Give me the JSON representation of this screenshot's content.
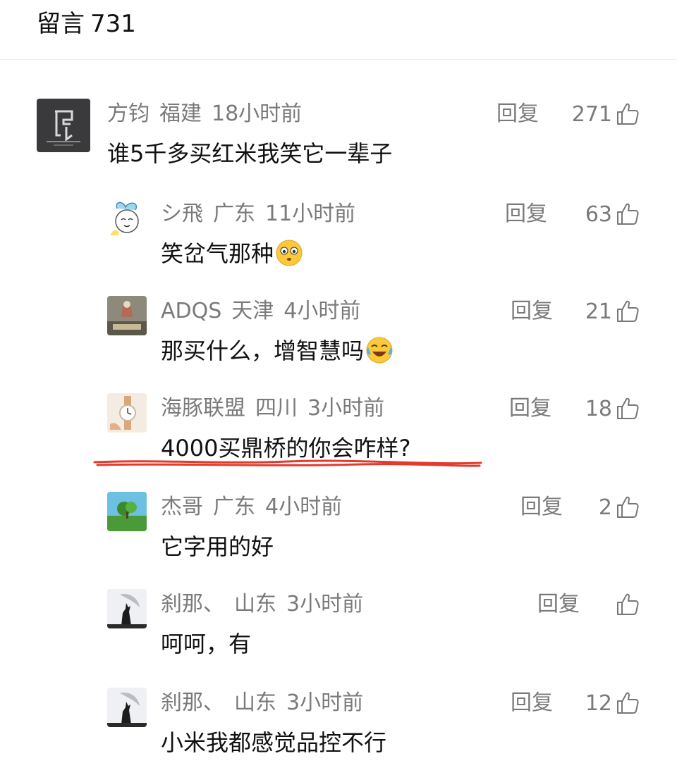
{
  "header": {
    "title": "留言",
    "count": "731"
  },
  "comments": [
    {
      "user": "方钧",
      "region": "福建",
      "time": "18小时前",
      "text": "谁5千多买红米我笑它一辈子",
      "reply_label": "回复",
      "likes": "271",
      "avatar_icon": "brand-logo-avatar"
    },
    {
      "user": "シ飛",
      "region": "广东",
      "time": "11小时前",
      "text": "笑岔气那种",
      "emoji": "flushed-face-emoji",
      "reply_label": "回复",
      "likes": "63",
      "avatar_icon": "cartoon-avatar"
    },
    {
      "user": "ADQS",
      "region": "天津",
      "time": "4小时前",
      "text": "那买什么，增智慧吗",
      "emoji": "crying-laughing-emoji",
      "reply_label": "回复",
      "likes": "21",
      "avatar_icon": "photo-avatar"
    },
    {
      "user": "海豚联盟",
      "region": "四川",
      "time": "3小时前",
      "text": "4000买鼎桥的你会咋样?",
      "reply_label": "回复",
      "likes": "18",
      "avatar_icon": "watch-avatar"
    },
    {
      "user": "杰哥",
      "region": "广东",
      "time": "4小时前",
      "text": "它字用的好",
      "reply_label": "回复",
      "likes": "2",
      "avatar_icon": "landscape-avatar"
    },
    {
      "user": "刹那、",
      "region": "山东",
      "time": "3小时前",
      "text": "呵呵，有",
      "reply_label": "回复",
      "likes": "",
      "avatar_icon": "wolf-avatar"
    },
    {
      "user": "刹那、",
      "region": "山东",
      "time": "3小时前",
      "text": "小米我都感觉品控不行",
      "reply_label": "回复",
      "likes": "12",
      "avatar_icon": "wolf-avatar"
    }
  ],
  "icons": {
    "like": "thumbs-up-icon"
  },
  "colors": {
    "meta_text": "#7a7a7a",
    "body_text": "#111111",
    "underline_mark": "#e23b2e"
  }
}
